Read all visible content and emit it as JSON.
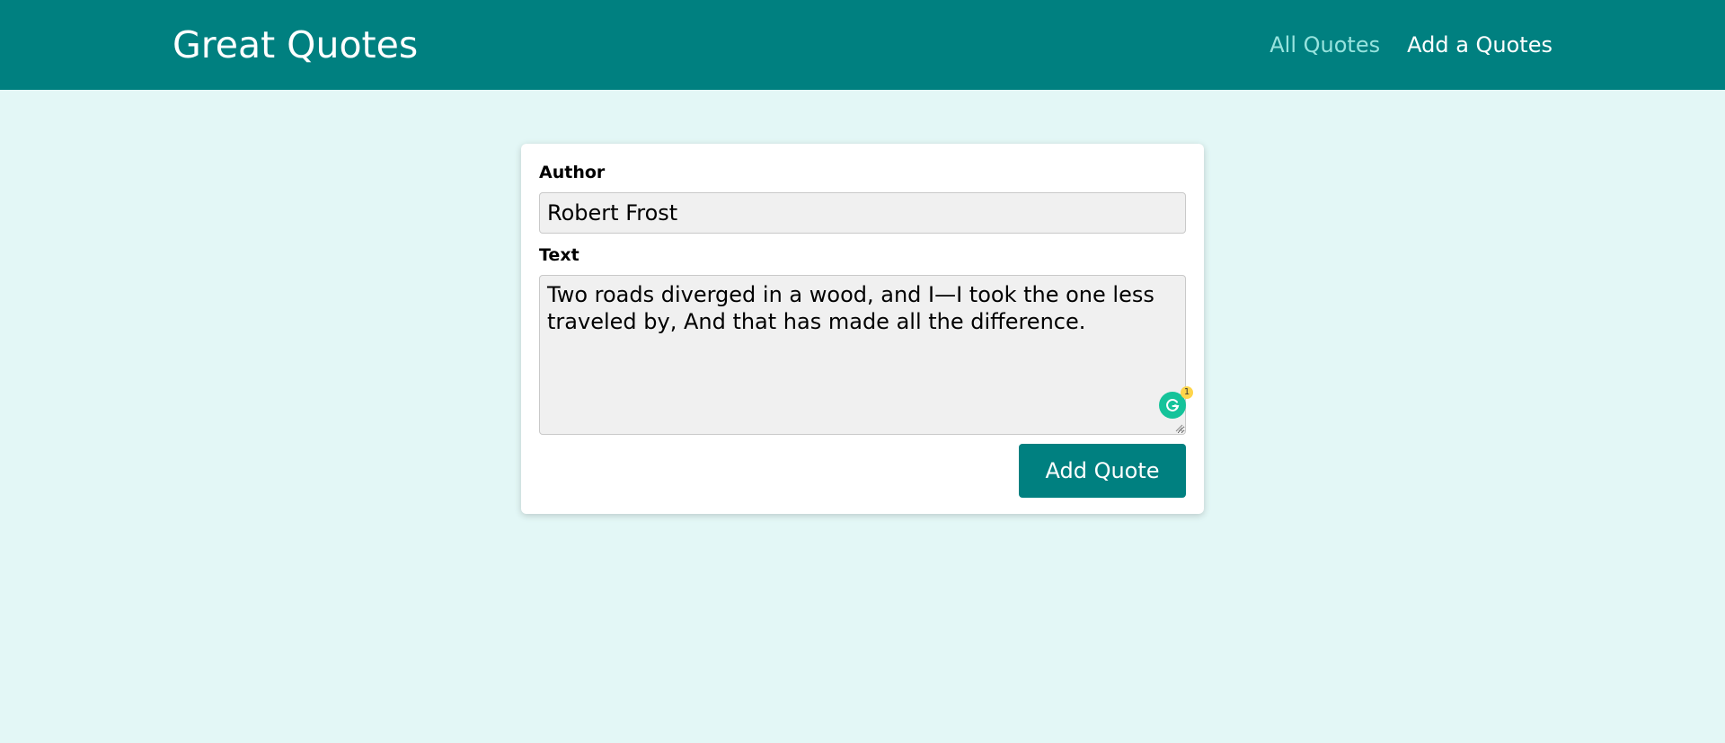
{
  "header": {
    "title": "Great Quotes",
    "nav": [
      {
        "label": "All Quotes",
        "active": false
      },
      {
        "label": "Add a Quotes",
        "active": true
      }
    ]
  },
  "form": {
    "author_label": "Author",
    "author_value": "Robert Frost",
    "text_label": "Text",
    "text_value": "Two roads diverged in a wood, and I—I took the one less traveled by, And that has made all the difference.",
    "submit_label": "Add Quote",
    "grammarly_count": "1"
  },
  "colors": {
    "header_bg": "#008080",
    "page_bg": "#e3f7f6",
    "nav_inactive": "#97e3de",
    "button_bg": "#008080",
    "grammarly": "#15c39a"
  },
  "icons": [
    "grammarly-icon",
    "resize-grip-icon"
  ]
}
